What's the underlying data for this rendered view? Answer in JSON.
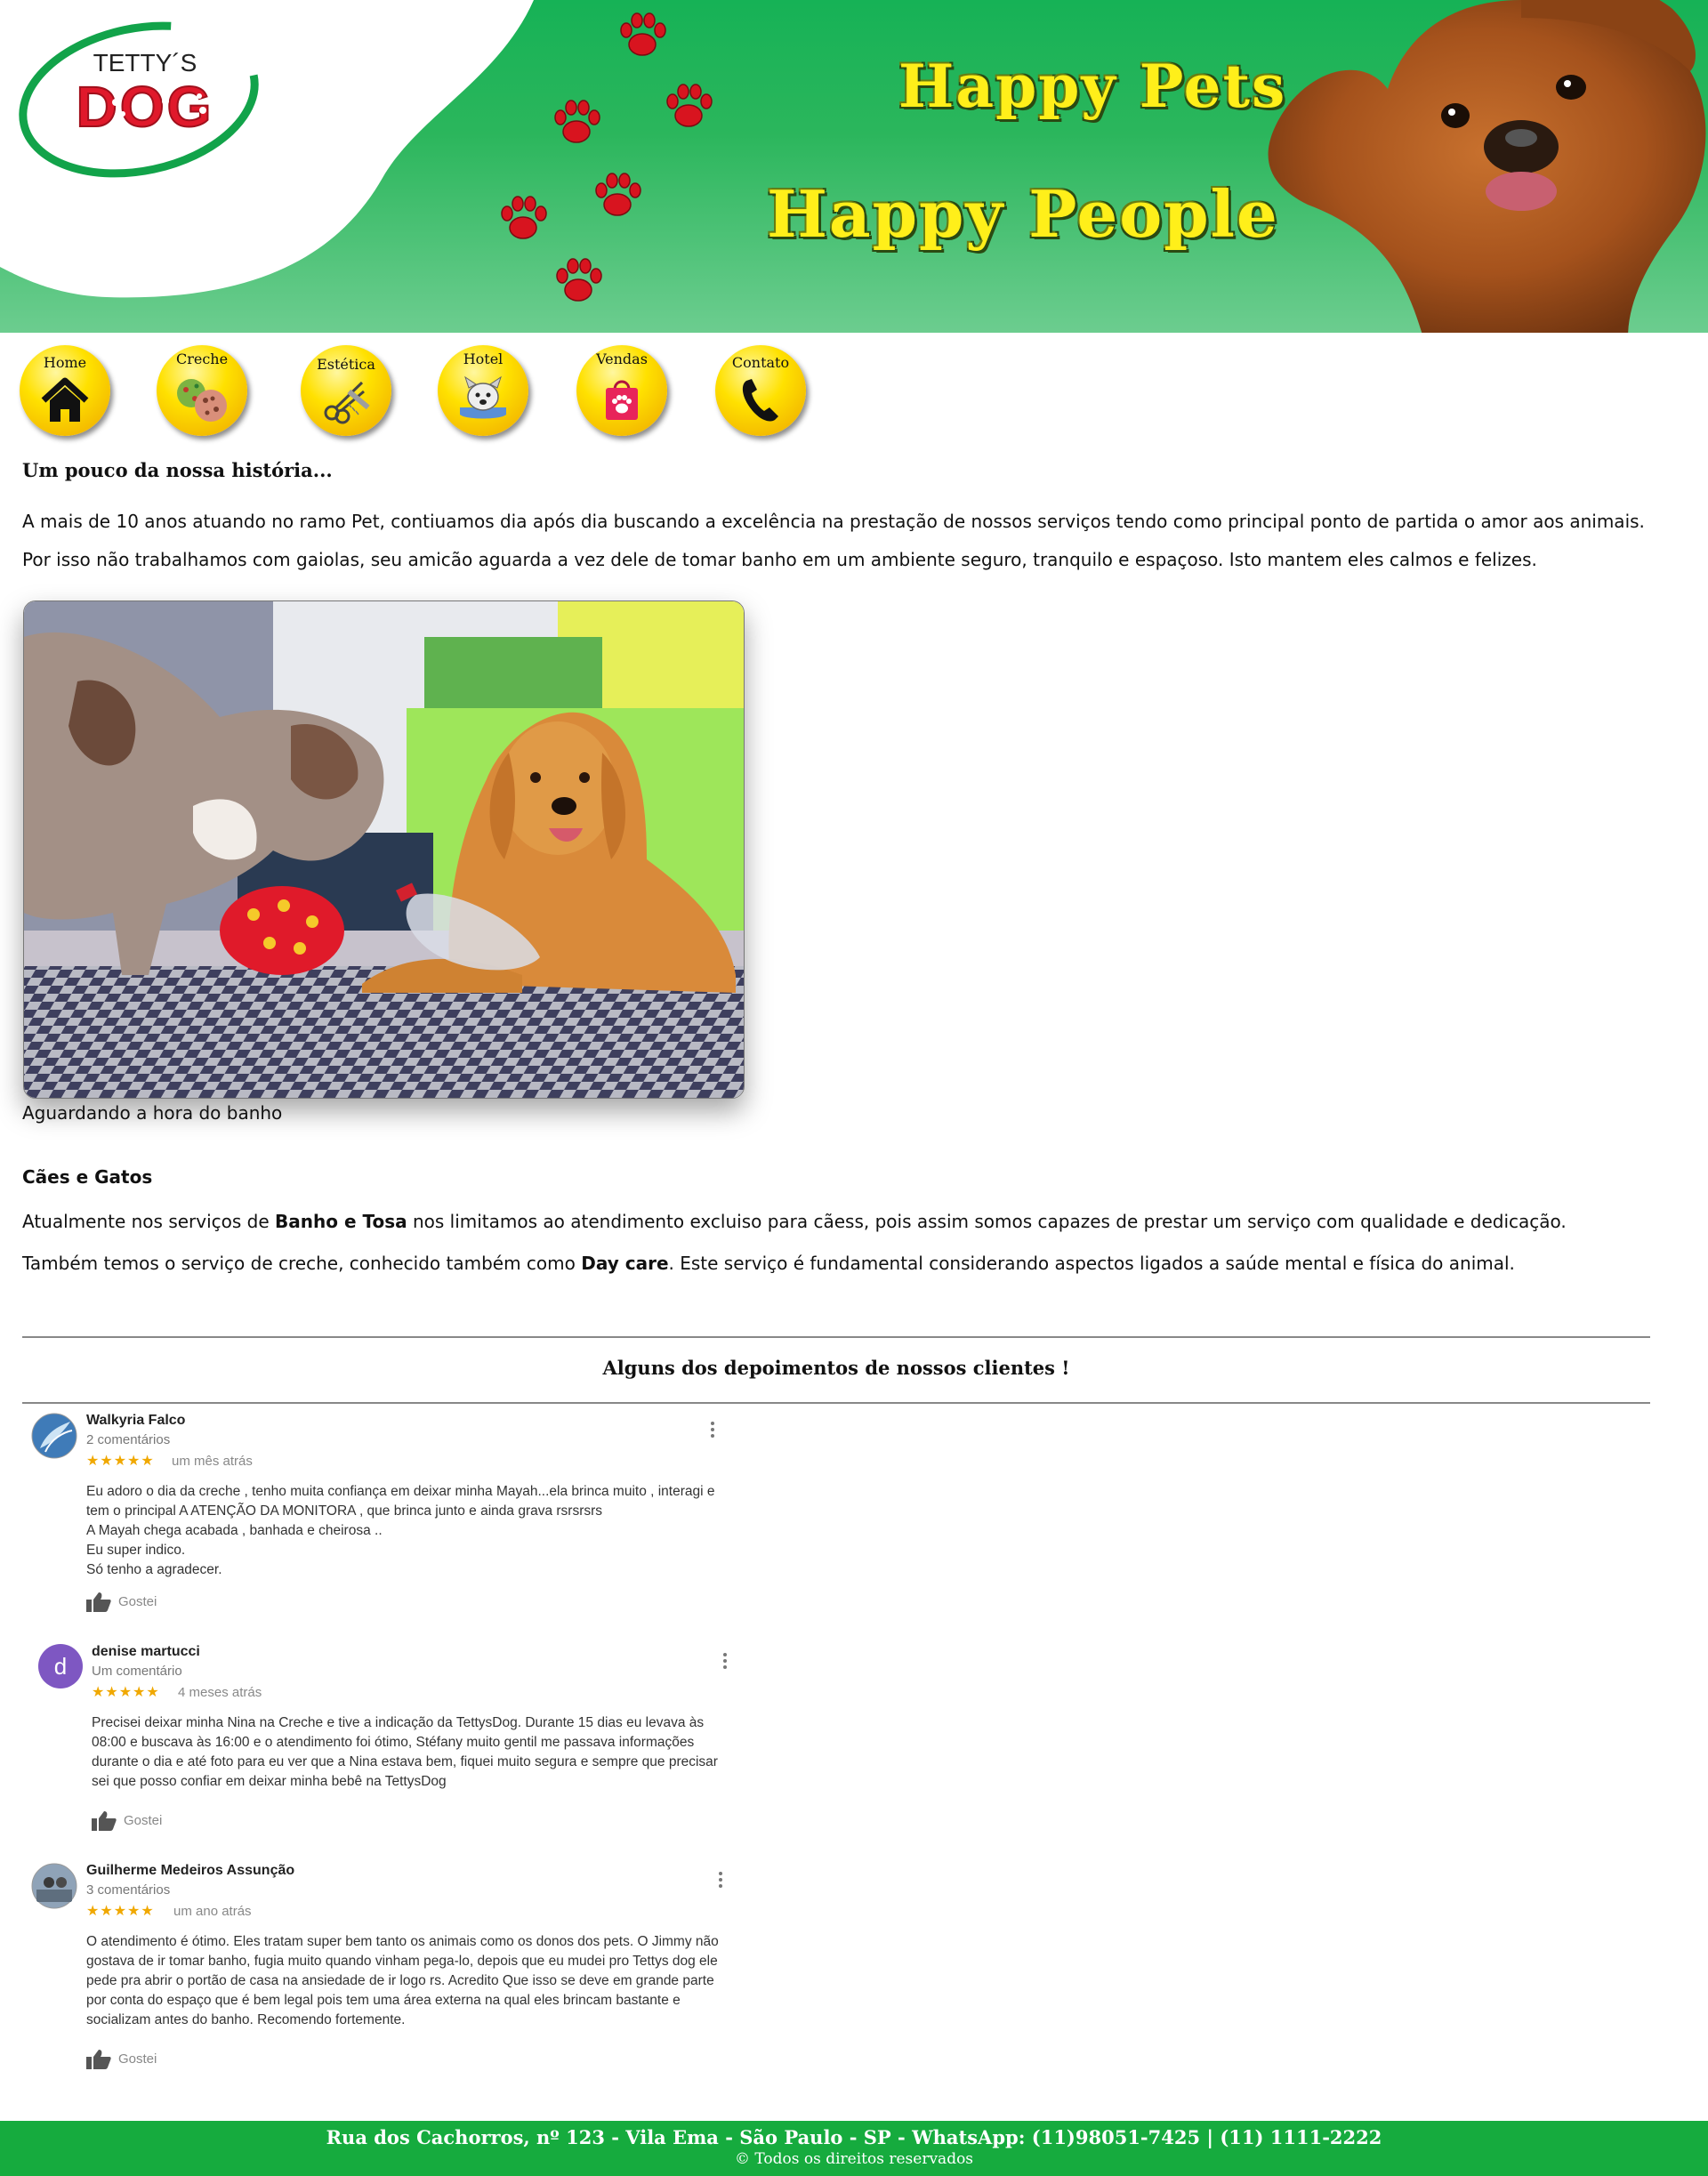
{
  "banner": {
    "logo_top": "TETTY´S",
    "logo_main": "DOG",
    "slogan_1": "Happy Pets",
    "slogan_2": "Happy People"
  },
  "nav": {
    "items": [
      {
        "label": "Home",
        "icon": "house-icon"
      },
      {
        "label": "Creche",
        "icon": "balls-icon"
      },
      {
        "label": "Estética",
        "icon": "scissors-comb-icon"
      },
      {
        "label": "Hotel",
        "icon": "dog-bed-icon"
      },
      {
        "label": "Vendas",
        "icon": "shopping-bag-icon"
      },
      {
        "label": "Contato",
        "icon": "phone-icon"
      }
    ]
  },
  "history": {
    "heading": "Um pouco da nossa história...",
    "p1": "A mais de 10 anos atuando no ramo Pet, contiuamos dia após dia buscando a excelência na prestação de nossos serviços tendo como principal ponto de partida o amor aos animais.",
    "p2": "Por isso não trabalhamos com gaiolas, seu amicão aguarda a vez dele de tomar banho em um ambiente seguro, tranquilo e espaçoso. Isto mantem eles calmos e felizes.",
    "caption": "Aguardando a hora do banho"
  },
  "caes": {
    "heading": "Cães e Gatos",
    "p1_a": "Atualmente nos serviços de ",
    "p1_b": "Banho e Tosa",
    "p1_c": " nos limitamos ao atendimento excluiso para cãess, pois assim somos capazes de prestar um serviço com qualidade e dedicação.",
    "p2_a": "Também temos o serviço de creche, conhecido também como ",
    "p2_b": "Day care",
    "p2_c": ". Este serviço é fundamental considerando aspectos ligados a saúde mental e física do animal."
  },
  "testimonials": {
    "title": "Alguns dos depoimentos de nossos clientes !",
    "reviews": [
      {
        "name": "Walkyria Falco",
        "count": "2 comentários",
        "stars": "★★★★★",
        "date": "um mês atrás",
        "text": "Eu adoro o dia da creche , tenho muita confiança em deixar minha Mayah...ela brinca muito , interagi e\ntem o principal A ATENÇÃO DA MONITORA , que brinca junto e ainda grava rsrsrsrs\nA Mayah chega acabada , banhada e cheirosa ..\nEu super indico.\nSó tenho a agradecer.",
        "like": "Gostei"
      },
      {
        "name": "denise martucci",
        "count": "Um comentário",
        "stars": "★★★★★",
        "date": "4 meses atrás",
        "avatar_letter": "d",
        "text": "Precisei deixar minha Nina na Creche e tive a indicação da TettysDog. Durante 15 dias eu levava às\n08:00 e buscava às 16:00 e o atendimento foi ótimo, Stéfany muito gentil me passava informações\ndurante o dia e até foto para eu ver que a Nina estava bem, fiquei muito segura e sempre que precisar\nsei que posso confiar em deixar minha bebê na TettysDog",
        "like": "Gostei"
      },
      {
        "name": "Guilherme Medeiros Assunção",
        "count": "3 comentários",
        "stars": "★★★★★",
        "date": "um ano atrás",
        "text": "O atendimento é ótimo. Eles tratam super bem tanto os animais como os donos dos pets. O Jimmy não\ngostava de ir tomar banho, fugia muito quando vinham pega-lo, depois que eu mudei pro Tettys dog ele\npede pra abrir o portão de casa na ansiedade de ir logo rs. Acredito Que isso se deve em grande parte\npor conta do espaço que é bem legal pois tem uma área externa na qual eles brincam bastante e\nsocializam antes do banho. Recomendo fortemente.",
        "like": "Gostei"
      }
    ]
  },
  "footer": {
    "address": "Rua dos Cachorros, nº 123 - Vila Ema - São Paulo - SP - WhatsApp: (11)98051-7425 | (11) 1111-2222",
    "copyright": "© Todos os direitos reservados"
  },
  "colors": {
    "brand_green": "#16ab3e",
    "nav_yellow": "#ffe100",
    "logo_red": "#e0192b",
    "star": "#f0a800"
  }
}
